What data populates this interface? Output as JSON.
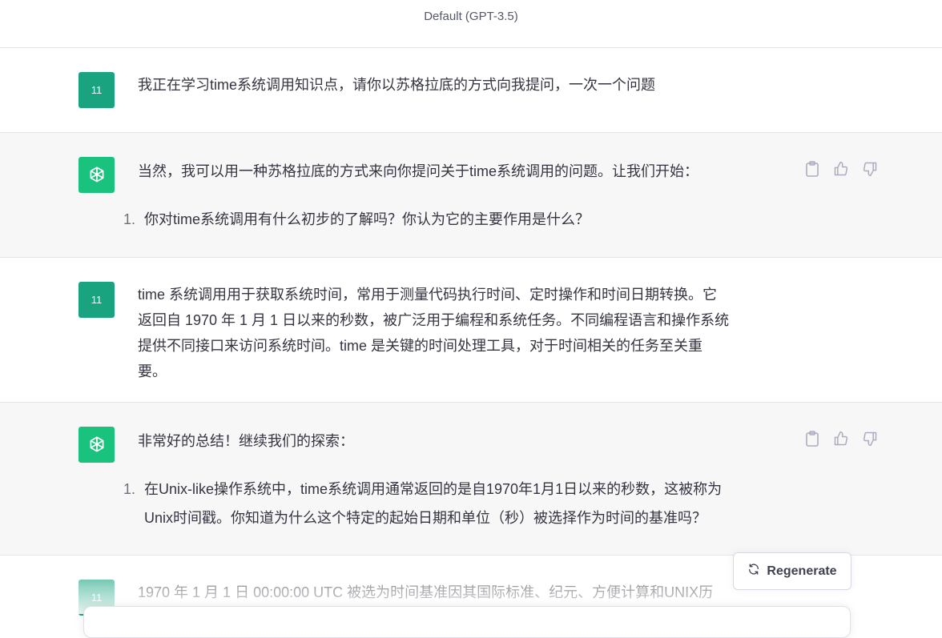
{
  "header": {
    "model_label": "Default (GPT-3.5)"
  },
  "avatars": {
    "user_initials": "11"
  },
  "messages": [
    {
      "role": "user",
      "text": "我正在学习time系统调用知识点，请你以苏格拉底的方式向我提问，一次一个问题"
    },
    {
      "role": "assistant",
      "intro": "当然，我可以用一种苏格拉底的方式来向你提问关于time系统调用的问题。让我们开始：",
      "list_num": "1.",
      "list_text": "你对time系统调用有什么初步的了解吗？你认为它的主要作用是什么？"
    },
    {
      "role": "user",
      "lines": [
        "time 系统调用用于获取系统时间，常用于测量代码执行时间、定时操作和时间日期转换。它",
        "返回自 1970 年 1 月 1 日以来的秒数，被广泛用于编程和系统任务。不同编程语言和操作系统",
        "提供不同接口来访问系统时间。time 是关键的时间处理工具，对于时间相关的任务至关重",
        "要。"
      ]
    },
    {
      "role": "assistant",
      "intro": "非常好的总结！继续我们的探索：",
      "list_num": "1.",
      "list_lines": [
        "在Unix-like操作系统中，time系统调用通常返回的是自1970年1月1日以来的秒数，这被称为",
        "Unix时间戳。你知道为什么这个特定的起始日期和单位（秒）被选择作为时间的基准吗？"
      ]
    },
    {
      "role": "user",
      "text": "1970 年 1 月 1 日 00:00:00 UTC 被选为时间基准因其国际标准、纪元、方便计算和UNIX历"
    }
  ],
  "actions": {
    "copy_icon": "clipboard-icon",
    "like_icon": "thumbs-up-icon",
    "dislike_icon": "thumbs-down-icon"
  },
  "regenerate": {
    "label": "Regenerate",
    "icon": "refresh-icon"
  },
  "colors": {
    "user_avatar": "#19a37f",
    "bot_avatar": "#19c37d",
    "assistant_bg": "#f7f7f8"
  }
}
